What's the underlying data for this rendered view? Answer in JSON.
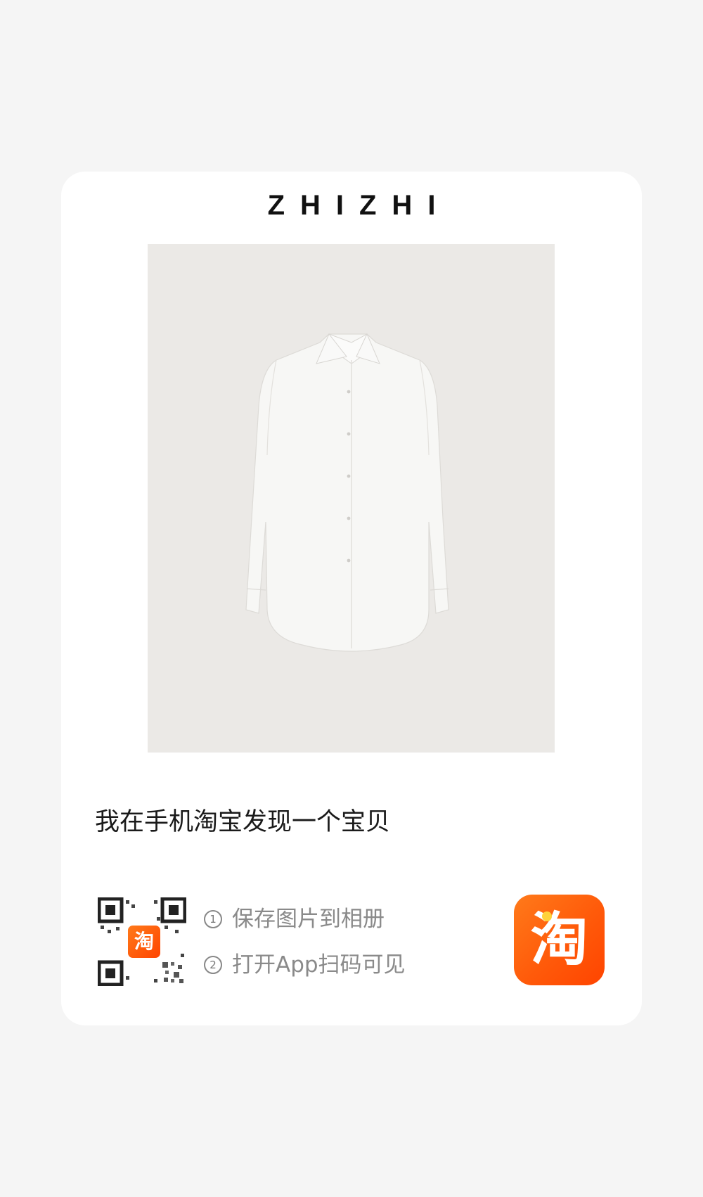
{
  "brand": "ZHIZHI",
  "product_image": {
    "subject": "white-shirt"
  },
  "headline": "我在手机淘宝发现一个宝贝",
  "steps": [
    {
      "num": "1",
      "text": "保存图片到相册"
    },
    {
      "num": "2",
      "text": "打开App扫码可见"
    }
  ],
  "app_icon": {
    "glyph": "淘",
    "icon": "taobao-app-icon",
    "color": "#ff5000"
  },
  "qr": {
    "icon": "qr-code",
    "center_glyph": "淘"
  },
  "colors": {
    "background": "#f5f5f5",
    "card": "#ffffff",
    "image_bg": "#ebe9e6",
    "accent": "#ff5000",
    "muted_text": "#8a8a8a"
  }
}
